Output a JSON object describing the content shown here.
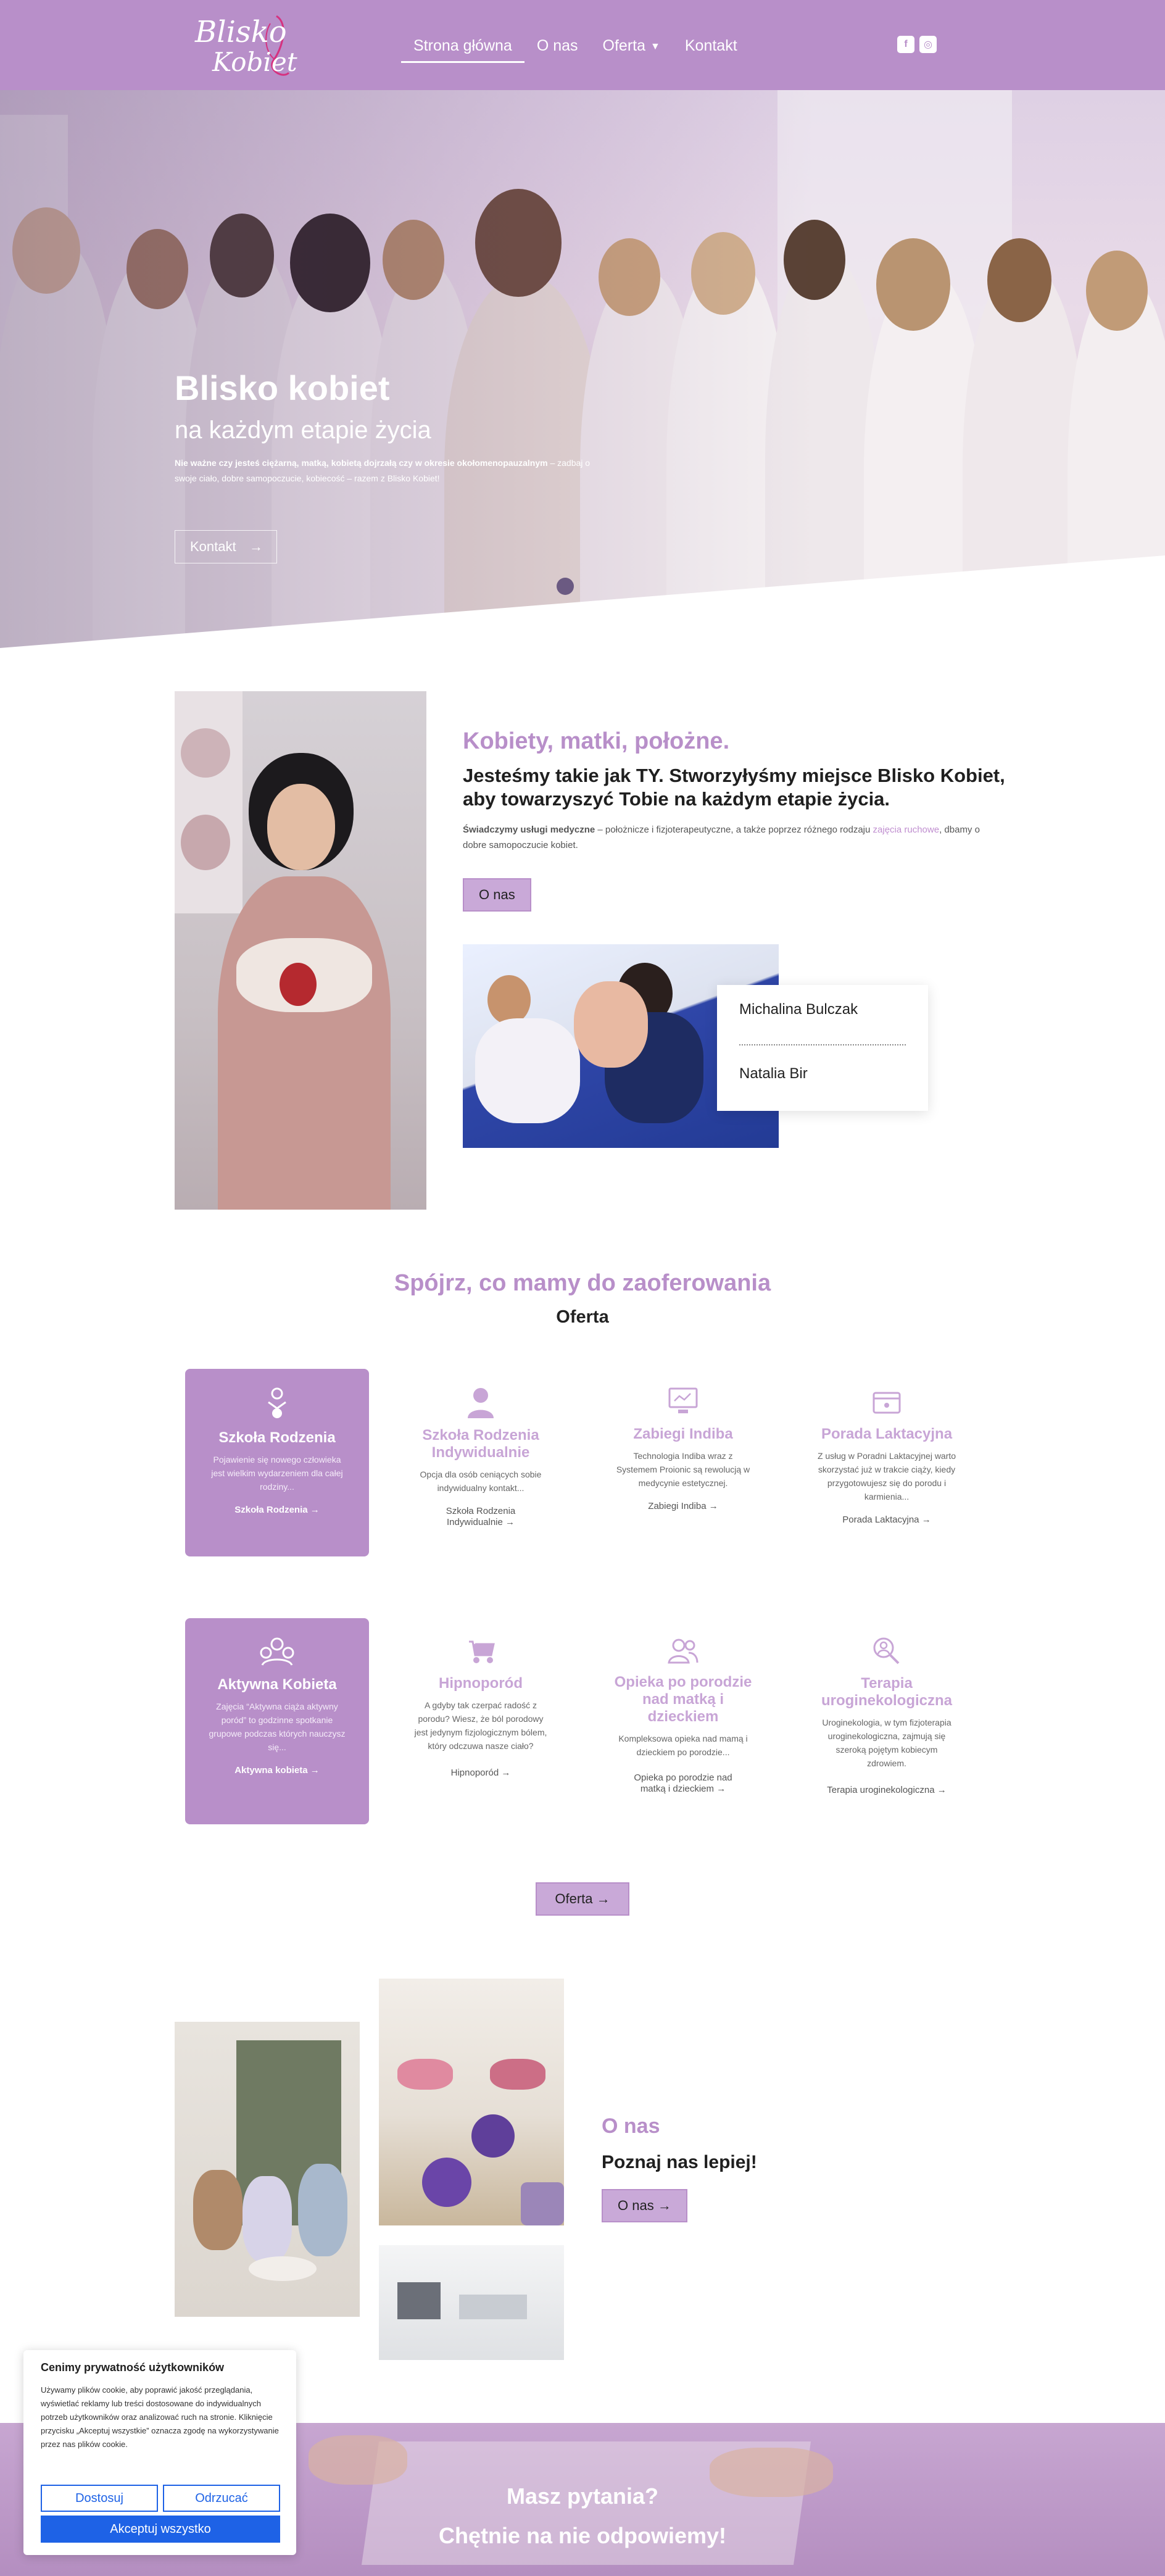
{
  "colors": {
    "brand": "#b88fc9",
    "brand_light": "#c9a9d8",
    "cookie_blue": "#1e62e6"
  },
  "header": {
    "logo_line1": "Blisko",
    "logo_line2": "Kobiet",
    "nav": [
      {
        "label": "Strona główna"
      },
      {
        "label": "O nas"
      },
      {
        "label": "Oferta"
      },
      {
        "label": "Kontakt"
      }
    ],
    "social_icons": [
      "facebook-icon",
      "instagram-icon"
    ]
  },
  "hero": {
    "title": "Blisko kobiet",
    "subtitle": "na każdym etapie życia",
    "text_bold": "Nie ważne czy jesteś ciężarną, matką, kobietą dojrzałą czy w okresie okołomenopauzalnym",
    "text_rest": " – zadbaj o swoje ciało, dobre samopoczucie, kobiecość – razem z Blisko Kobiet!",
    "button": "Kontakt"
  },
  "about": {
    "title": "Kobiety, matki, położne.",
    "lead": "Jesteśmy takie jak TY. Stworzyłyśmy miejsce Blisko Kobiet, aby towarzyszyć Tobie na każdym etapie życia.",
    "text_bold": "Świadczymy usługi medyczne",
    "text_mid": " – położnicze i fizjoterapeutyczne, a także poprzez różnego rodzaju ",
    "text_link": "zajęcia ruchowe",
    "text_end": ", dbamy o dobre samopoczucie kobiet.",
    "button": "O nas",
    "team": [
      "Michalina Bulczak",
      "Natalia Bir"
    ]
  },
  "offer": {
    "title": "Spójrz, co mamy do zaoferowania",
    "subtitle": "Oferta",
    "cards": [
      {
        "icon": "baby-icon",
        "title": "Szkoła Rodzenia",
        "desc": "Pojawienie się nowego człowieka jest wielkim wydarzeniem dla całej rodziny...",
        "link": "Szkoła Rodzenia"
      },
      {
        "icon": "user-icon",
        "title": "Szkoła Rodzenia Indywidualnie",
        "desc": "Opcja dla osób ceniących sobie indywidualny kontakt...",
        "link": "Szkoła Rodzenia Indywidualnie"
      },
      {
        "icon": "monitor-icon",
        "title": "Zabiegi Indiba",
        "desc": "Technologia Indiba wraz z Systemem Proionic są rewolucją w medycynie estetycznej.",
        "link": "Zabiegi Indiba"
      },
      {
        "icon": "calendar-icon",
        "title": "Porada Laktacyjna",
        "desc": "Z usług w Poradni Laktacyjnej warto skorzystać już w trakcie ciąży, kiedy przygotowujesz się do porodu i karmienia...",
        "link": "Porada Laktacyjna"
      },
      {
        "icon": "group-icon",
        "title": "Aktywna Kobieta",
        "desc": "Zajęcia “Aktywna ciąża aktywny poród” to godzinne spotkanie grupowe podczas których nauczysz się...",
        "link": "Aktywna kobieta"
      },
      {
        "icon": "stroller-icon",
        "title": "Hipnoporód",
        "desc": "A gdyby tak czerpać radość z porodu? Wiesz, że ból porodowy jest jedynym fizjologicznym bólem, który odczuwa nasze ciało?",
        "link": "Hipnoporód"
      },
      {
        "icon": "users-icon",
        "title": "Opieka po porodzie nad matką i dzieckiem",
        "desc": "Kompleksowa opieka nad mamą i dzieckiem po porodzie...",
        "link": "Opieka po porodzie nad matką i dzieckiem"
      },
      {
        "icon": "search-user-icon",
        "title": "Terapia uroginekologiczna",
        "desc": "Uroginekologia, w tym fizjoterapia uroginekologiczna, zajmują się szeroką pojętym kobiecym zdrowiem.",
        "link": "Terapia uroginekologiczna"
      }
    ],
    "button": "Oferta"
  },
  "onas": {
    "title": "O nas",
    "subtitle": "Poznaj nas lepiej!",
    "button": "O nas"
  },
  "cookie": {
    "heading": "Cenimy prywatność użytkowników",
    "body": "Używamy plików cookie, aby poprawić jakość przeglądania, wyświetlać reklamy lub treści dostosowane do indywidualnych potrzeb użytkowników oraz analizować ruch na stronie. Kliknięcie przycisku „Akceptuj wszystkie” oznacza zgodę na wykorzystywanie przez nas plików cookie.",
    "customize": "Dostosuj",
    "reject": "Odrzucać",
    "accept": "Akceptuj wszystko"
  },
  "bottom": {
    "line1": "Masz pytania?",
    "line2": "Chętnie na nie odpowiemy!"
  }
}
